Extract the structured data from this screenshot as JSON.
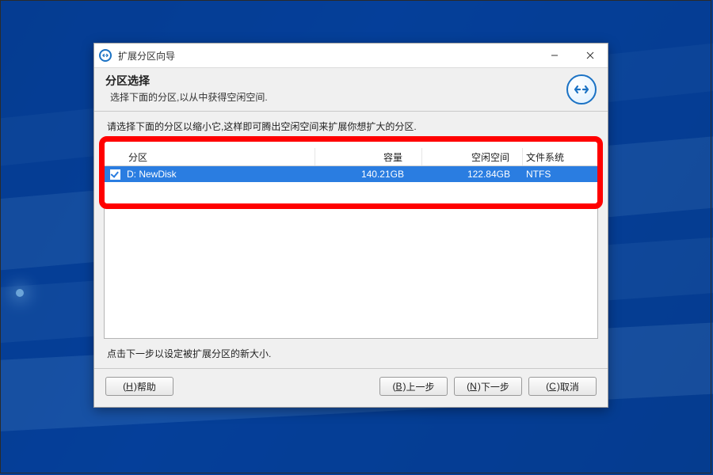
{
  "window": {
    "title": "扩展分区向导"
  },
  "header": {
    "title": "分区选择",
    "subtitle": "选择下面的分区,以从中获得空闲空间."
  },
  "instruction": "请选择下面的分区以缩小它,这样即可腾出空闲空间来扩展你想扩大的分区.",
  "columns": {
    "partition": "分区",
    "size": "容量",
    "free": "空闲空间",
    "fs": "文件系统"
  },
  "rows": [
    {
      "checked": true,
      "selected": true,
      "partition": "D: NewDisk",
      "size": "140.21GB",
      "free": "122.84GB",
      "fs": "NTFS"
    }
  ],
  "hint": "点击下一步以设定被扩展分区的新大小.",
  "buttons": {
    "help": {
      "accel": "H",
      "label": "帮助"
    },
    "back": {
      "accel": "B",
      "label": "上一步"
    },
    "next": {
      "accel": "N",
      "label": "下一步"
    },
    "cancel": {
      "accel": "C",
      "label": "取消"
    }
  }
}
